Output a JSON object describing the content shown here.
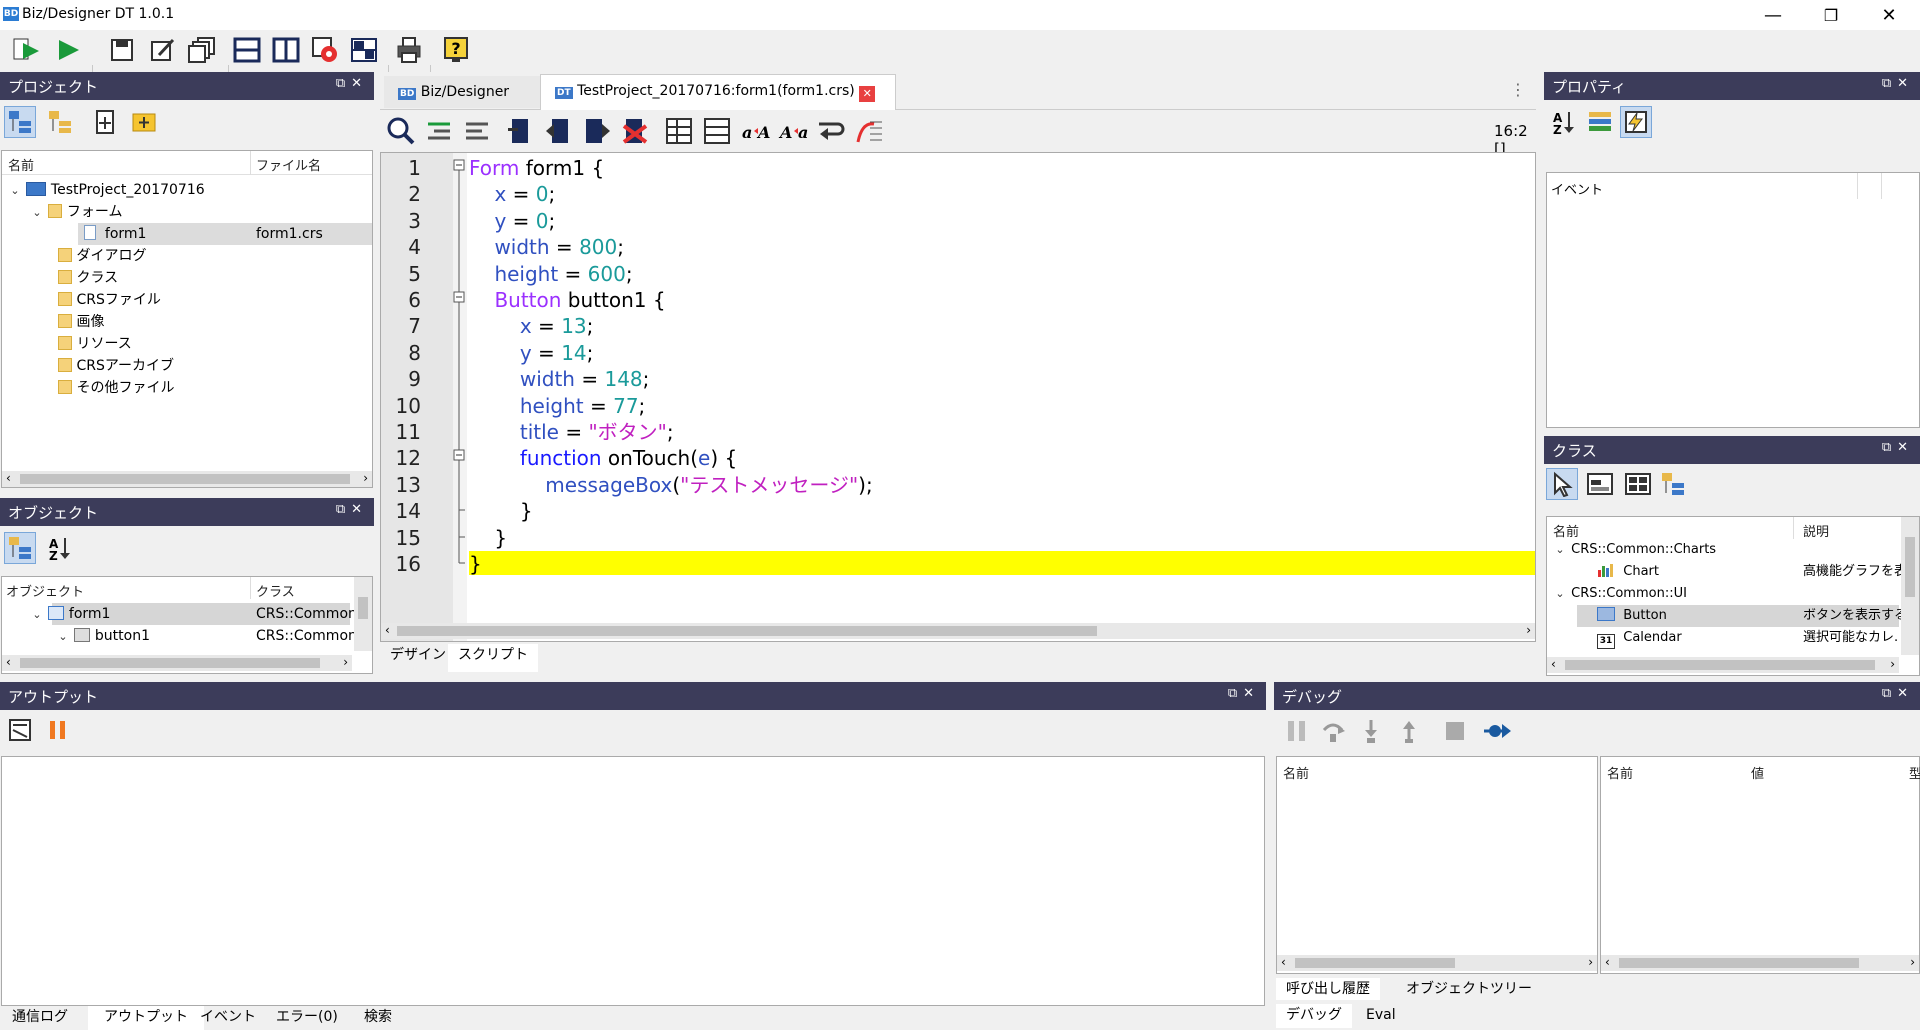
{
  "window": {
    "title": "Biz/Designer DT 1.0.1",
    "logo": "BD",
    "minimize": "—",
    "maximize": "❐",
    "close": "✕"
  },
  "toolbar": {
    "icons": [
      "run-debug-icon",
      "run-icon",
      "save-icon",
      "edit-icon",
      "windows-icon",
      "layout-h-icon",
      "layout-v-icon",
      "settings-icon",
      "grid-icon",
      "print-icon",
      "help-icon"
    ]
  },
  "project_panel": {
    "title": "プロジェクト",
    "col_name": "名前",
    "col_file": "ファイル名",
    "root": "TestProject_20170716",
    "forms_folder": "フォーム",
    "form_item": "form1",
    "form_file": "form1.crs",
    "folders": [
      "ダイアログ",
      "クラス",
      "CRSファイル",
      "画像",
      "リソース",
      "CRSアーカイブ",
      "その他ファイル"
    ]
  },
  "object_panel": {
    "title": "オブジェクト",
    "col_object": "オブジェクト",
    "col_class": "クラス",
    "rows": [
      {
        "name": "form1",
        "class": "CRS::Common:"
      },
      {
        "name": "button1",
        "class": "CRS::Common:"
      }
    ]
  },
  "editor": {
    "tabs": [
      {
        "label": "Biz/Designer",
        "prefix": "BD"
      },
      {
        "label": "TestProject_20170716:form1(form1.crs)",
        "prefix": "DT"
      }
    ],
    "tab_close": "✕",
    "more": "⋮",
    "cursor_pos": "16:2 []",
    "bottom_tabs": [
      "デザイン",
      "スクリプト"
    ],
    "line_numbers": [
      "1",
      "2",
      "3",
      "4",
      "5",
      "6",
      "7",
      "8",
      "9",
      "10",
      "11",
      "12",
      "13",
      "14",
      "15",
      "16"
    ]
  },
  "properties_panel": {
    "title": "プロパティ",
    "event_label": "イベント"
  },
  "class_panel": {
    "title": "クラス",
    "col_name": "名前",
    "col_desc": "説明",
    "rows": [
      {
        "name": "CRS::Common::Charts",
        "desc": ""
      },
      {
        "name": "Chart",
        "desc": "高機能グラフを表"
      },
      {
        "name": "CRS::Common::UI",
        "desc": ""
      },
      {
        "name": "Button",
        "desc": "ボタンを表示する"
      },
      {
        "name": "Calendar",
        "desc": "選択可能なカレ."
      }
    ],
    "calendar_icon": "31"
  },
  "output_panel": {
    "title": "アウトプット",
    "bottom_tabs": [
      "通信ログ",
      "アウトプット",
      "イベント",
      "エラー(0)",
      "検索"
    ]
  },
  "debug_panel": {
    "title": "デバッグ",
    "left_col": "名前",
    "right_cols": [
      "名前",
      "値",
      "型"
    ],
    "tabs_row1": [
      "呼び出し履歴",
      "オブジェクトツリー"
    ],
    "tabs_row2": [
      "デバッグ",
      "Eval"
    ]
  },
  "colors": {
    "panel_header": "#3c3c5a",
    "highlight_line": "#ffff00",
    "selected_row": "#dcdcdc"
  }
}
